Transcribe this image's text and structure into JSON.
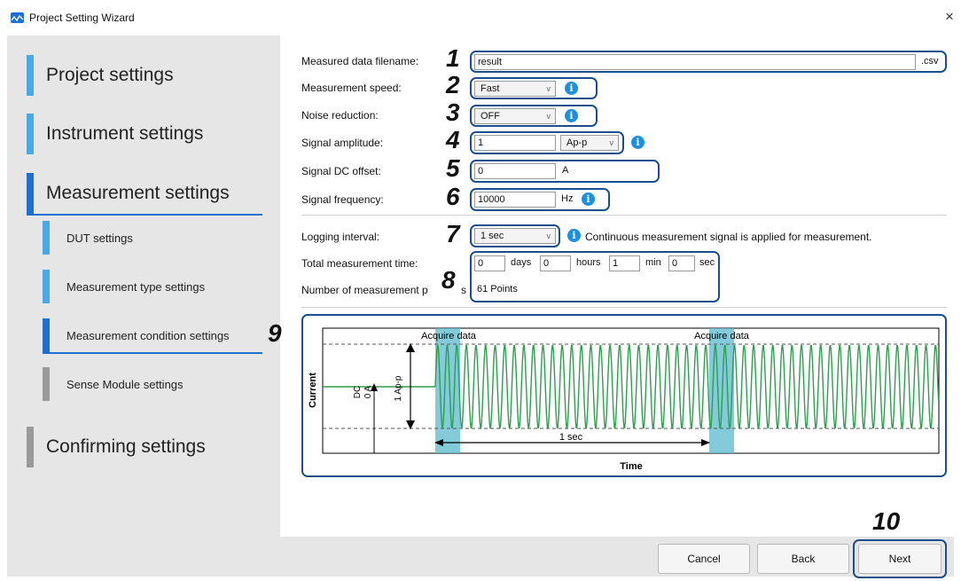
{
  "window": {
    "title": "Project Setting Wizard",
    "close": "×"
  },
  "sidebar": {
    "items": [
      {
        "label": "Project settings",
        "bar_color": "#4aa8e8"
      },
      {
        "label": "Instrument settings",
        "bar_color": "#4aa8e8"
      },
      {
        "label": "Measurement settings",
        "bar_color": "#1f6fd1",
        "active": true
      },
      {
        "label": "DUT settings",
        "bar_color": "#4aa8e8"
      },
      {
        "label": "Measurement type settings",
        "bar_color": "#4aa8e8"
      },
      {
        "label": "Measurement condition settings",
        "bar_color": "#1f6fd1",
        "active": true
      },
      {
        "label": "Sense Module settings",
        "bar_color": "#9a9a9a"
      },
      {
        "label": "Confirming settings",
        "bar_color": "#9a9a9a"
      }
    ]
  },
  "form": {
    "filename": {
      "label": "Measured data filename:",
      "value": "result",
      "ext": ".csv"
    },
    "speed": {
      "label": "Measurement speed:",
      "value": "Fast"
    },
    "noise": {
      "label": "Noise reduction:",
      "value": "OFF"
    },
    "amplitude": {
      "label": "Signal amplitude:",
      "value": "1",
      "unit": "Ap-p"
    },
    "dc_offset": {
      "label": "Signal DC offset:",
      "value": "0",
      "unit": "A"
    },
    "frequency": {
      "label": "Signal frequency:",
      "value": "10000",
      "unit": "Hz"
    },
    "logging": {
      "label": "Logging interval:",
      "value": "1 sec",
      "note": "Continuous measurement signal is applied for measurement."
    },
    "total_time": {
      "label": "Total measurement time:",
      "days": "0",
      "days_unit": "days",
      "hours": "0",
      "hours_unit": "hours",
      "min": "1",
      "min_unit": "min",
      "sec": "0",
      "sec_unit": "sec"
    },
    "points": {
      "label_visible": "Number of measurement p",
      "label_tail": "s",
      "value": "61 Points"
    }
  },
  "callouts": [
    "1",
    "2",
    "3",
    "4",
    "5",
    "6",
    "7",
    "8",
    "9",
    "10"
  ],
  "diagram": {
    "acquire_label": "Acquire data",
    "y_axis": "Current",
    "x_axis": "Time",
    "dc_label": "DC",
    "dc_value": "0 A",
    "amp_label": "1 Ap-p",
    "interval_label": "1 sec",
    "wave_color": "#2e9e4f",
    "highlight_color": "#5ab9cf"
  },
  "footer": {
    "cancel": "Cancel",
    "back": "Back",
    "next": "Next"
  },
  "info_glyph": "i",
  "chevron_glyph": "v"
}
